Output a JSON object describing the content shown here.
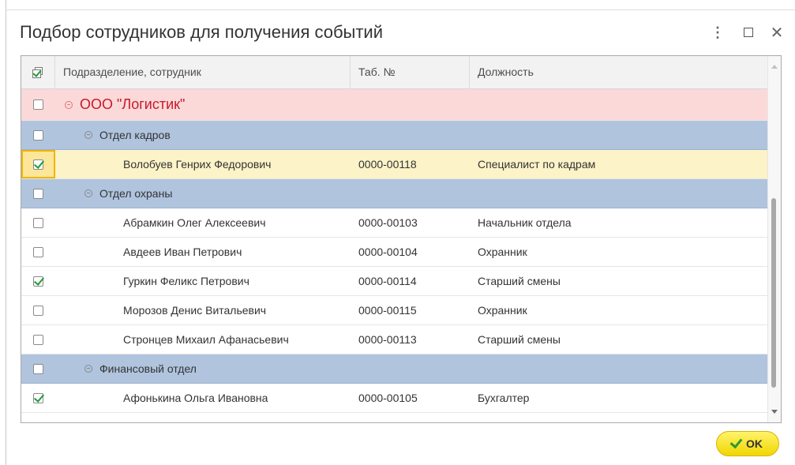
{
  "window": {
    "title": "Подбор сотрудников для получения событий",
    "menu_icon": "more-vertical-icon",
    "maximize_icon": "maximize-icon",
    "close_icon": "close-icon"
  },
  "grid": {
    "columns": {
      "select": "check-all-icon",
      "name": "Подразделение, сотрудник",
      "tab": "Таб. №",
      "position": "Должность"
    },
    "rows": [
      {
        "kind": "org",
        "checked": false,
        "name": "ООО \"Логистик\"",
        "tab": "",
        "position": ""
      },
      {
        "kind": "dept",
        "checked": false,
        "name": "Отдел кадров",
        "tab": "",
        "position": ""
      },
      {
        "kind": "sel",
        "checked": true,
        "name": "Волобуев Генрих Федорович",
        "tab": "0000-00118",
        "position": "Специалист по кадрам"
      },
      {
        "kind": "dept",
        "checked": false,
        "name": "Отдел охраны",
        "tab": "",
        "position": ""
      },
      {
        "kind": "emp",
        "checked": false,
        "name": "Абрамкин Олег Алексеевич",
        "tab": "0000-00103",
        "position": "Начальник отдела"
      },
      {
        "kind": "emp",
        "checked": false,
        "name": "Авдеев Иван Петрович",
        "tab": "0000-00104",
        "position": "Охранник"
      },
      {
        "kind": "emp",
        "checked": true,
        "name": "Гуркин Феликс Петрович",
        "tab": "0000-00114",
        "position": "Старший смены"
      },
      {
        "kind": "emp",
        "checked": false,
        "name": "Морозов Денис Витальевич",
        "tab": "0000-00115",
        "position": "Охранник"
      },
      {
        "kind": "emp",
        "checked": false,
        "name": "Стронцев Михаил Афанасьевич",
        "tab": "0000-00113",
        "position": "Старший смены"
      },
      {
        "kind": "dept",
        "checked": false,
        "name": "Финансовый отдел",
        "tab": "",
        "position": ""
      },
      {
        "kind": "emp",
        "checked": true,
        "name": "Афонькина Ольга Ивановна",
        "tab": "0000-00105",
        "position": "Бухгалтер"
      },
      {
        "kind": "emp",
        "checked": false,
        "name": "",
        "tab": "",
        "position": ""
      }
    ]
  },
  "footer": {
    "ok_label": "OK"
  },
  "colors": {
    "org_row": "#fbd9d9",
    "org_text": "#c8192b",
    "dept_row": "#b0c4de",
    "selected_row": "#fcf3c8",
    "check": "#1f9c3a",
    "ok_button": "#f1d600"
  }
}
